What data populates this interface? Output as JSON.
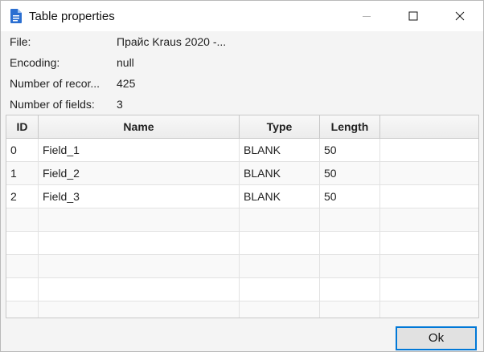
{
  "window": {
    "title": "Table properties",
    "icons": {
      "app": "document-icon",
      "minimize": "minimize-icon",
      "maximize": "maximize-icon",
      "close": "close-icon"
    }
  },
  "properties": [
    {
      "label": "File:",
      "value": "Прайс Kraus 2020 -..."
    },
    {
      "label": "Encoding:",
      "value": "null"
    },
    {
      "label": "Number of recor...",
      "value": "425"
    },
    {
      "label": "Number of fields:",
      "value": "3"
    }
  ],
  "table": {
    "columns": [
      "ID",
      "Name",
      "Type",
      "Length",
      ""
    ],
    "rows": [
      [
        "0",
        "Field_1",
        "BLANK",
        "50"
      ],
      [
        "1",
        "Field_2",
        "BLANK",
        "50"
      ],
      [
        "2",
        "Field_3",
        "BLANK",
        "50"
      ]
    ]
  },
  "buttons": {
    "ok": "Ok"
  },
  "colors": {
    "accent": "#0078d7",
    "icon_blue": "#2b6fd1"
  }
}
